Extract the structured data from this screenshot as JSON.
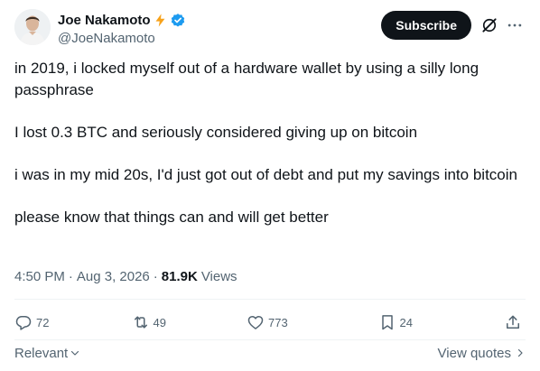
{
  "author": {
    "display_name": "Joe Nakamoto",
    "handle": "@JoeNakamoto",
    "badge_icons": [
      "lightning-icon",
      "verified-badge-icon"
    ],
    "verified_color": "#1d9bf0",
    "lightning_color": "#f7a21b"
  },
  "header": {
    "subscribe_label": "Subscribe"
  },
  "tweet": {
    "paragraphs": [
      "in 2019, i locked myself out of a hardware wallet by using a silly long passphrase",
      "I lost 0.3 BTC and seriously considered giving up on bitcoin",
      "i was in my mid 20s, I'd just got out of debt and put my savings into bitcoin",
      "please know that things can and will get better"
    ]
  },
  "meta": {
    "time": "4:50 PM",
    "separator": "·",
    "date": "Aug 3, 2026",
    "views_count": "81.9K",
    "views_label": "Views"
  },
  "engagement": {
    "replies": "72",
    "reposts": "49",
    "likes": "773",
    "bookmarks": "24"
  },
  "footer": {
    "sort_label": "Relevant",
    "view_quotes_label": "View quotes"
  },
  "colors": {
    "text_primary": "#0f1419",
    "text_secondary": "#536471",
    "divider": "#eff3f4",
    "subscribe_bg": "#0f1419"
  }
}
